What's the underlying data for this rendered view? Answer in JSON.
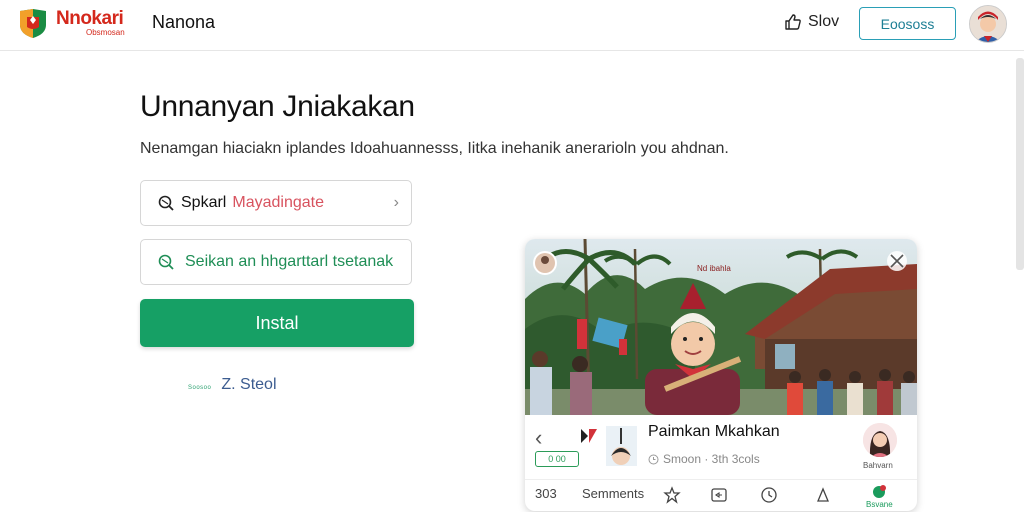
{
  "header": {
    "brand_main": "Nnokari",
    "brand_sub": "Obsmosan",
    "app_name": "Nanona",
    "like_label": "Slov",
    "cta_label": "Eoososs",
    "brand_colors": {
      "red": "#d4281c",
      "green": "#1a8c43",
      "orange": "#f2a02a"
    }
  },
  "hero": {
    "title": "Unnanyan Jniakakan",
    "subtitle": "Nenamgan hiaciakn iplandes Idoahuannesss, Iitka inehanik anerarioln you ahdnan."
  },
  "form": {
    "field1_label": "Spkarl",
    "field1_value": "Mayadingate",
    "field2_label": "Seikan an hhgarttarl tsetanak",
    "install_label": "Instal",
    "link_tiny": "Soosoo",
    "link_label": "Z. Steol"
  },
  "card": {
    "overlay_text": "Nd ibahla",
    "title": "Paimkan Mkahkan",
    "rating": "0 00",
    "meta": "Smoon · 3th 3cols",
    "creator_label": "Bahvarn",
    "nav": {
      "count": "303",
      "comments": "Semments",
      "last_label": "Bsvane"
    }
  },
  "icons": [
    "logo-shield-icon",
    "thumbs-up-icon",
    "avatar-icon",
    "search-icon",
    "chevron-right-icon",
    "leaf-icon",
    "back-chevron-icon",
    "close-icon",
    "star-icon",
    "reply-icon",
    "clock-icon",
    "bell-icon",
    "flag-badge-icon"
  ]
}
